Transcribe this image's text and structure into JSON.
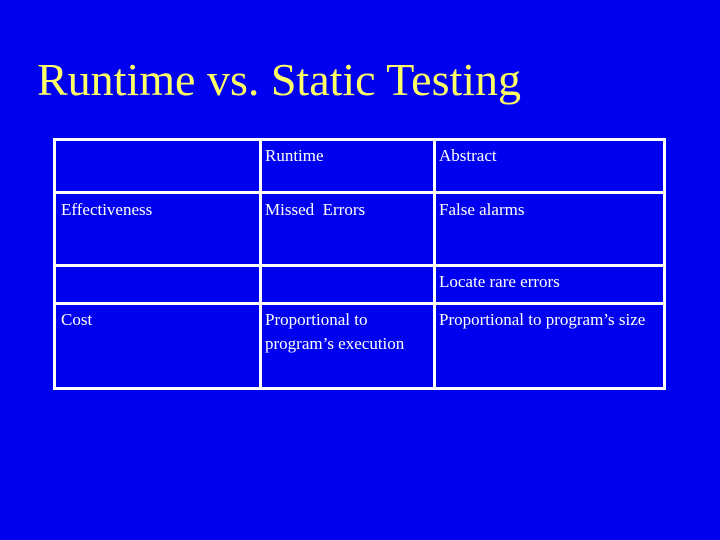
{
  "slide": {
    "title": "Runtime vs. Static Testing",
    "title_color": "#ffff66",
    "background_color": "#0000f0"
  },
  "table": {
    "columns": [
      "",
      "Runtime",
      "Abstract"
    ],
    "rows": [
      {
        "label": "Effectiveness",
        "runtime": "Missed  Errors",
        "abstract": "False alarms"
      },
      {
        "label": "",
        "runtime": "",
        "abstract": "Locate rare errors"
      },
      {
        "label": "Cost",
        "runtime": "Proportional to program’s execution",
        "abstract": "Proportional to program’s size"
      }
    ]
  }
}
